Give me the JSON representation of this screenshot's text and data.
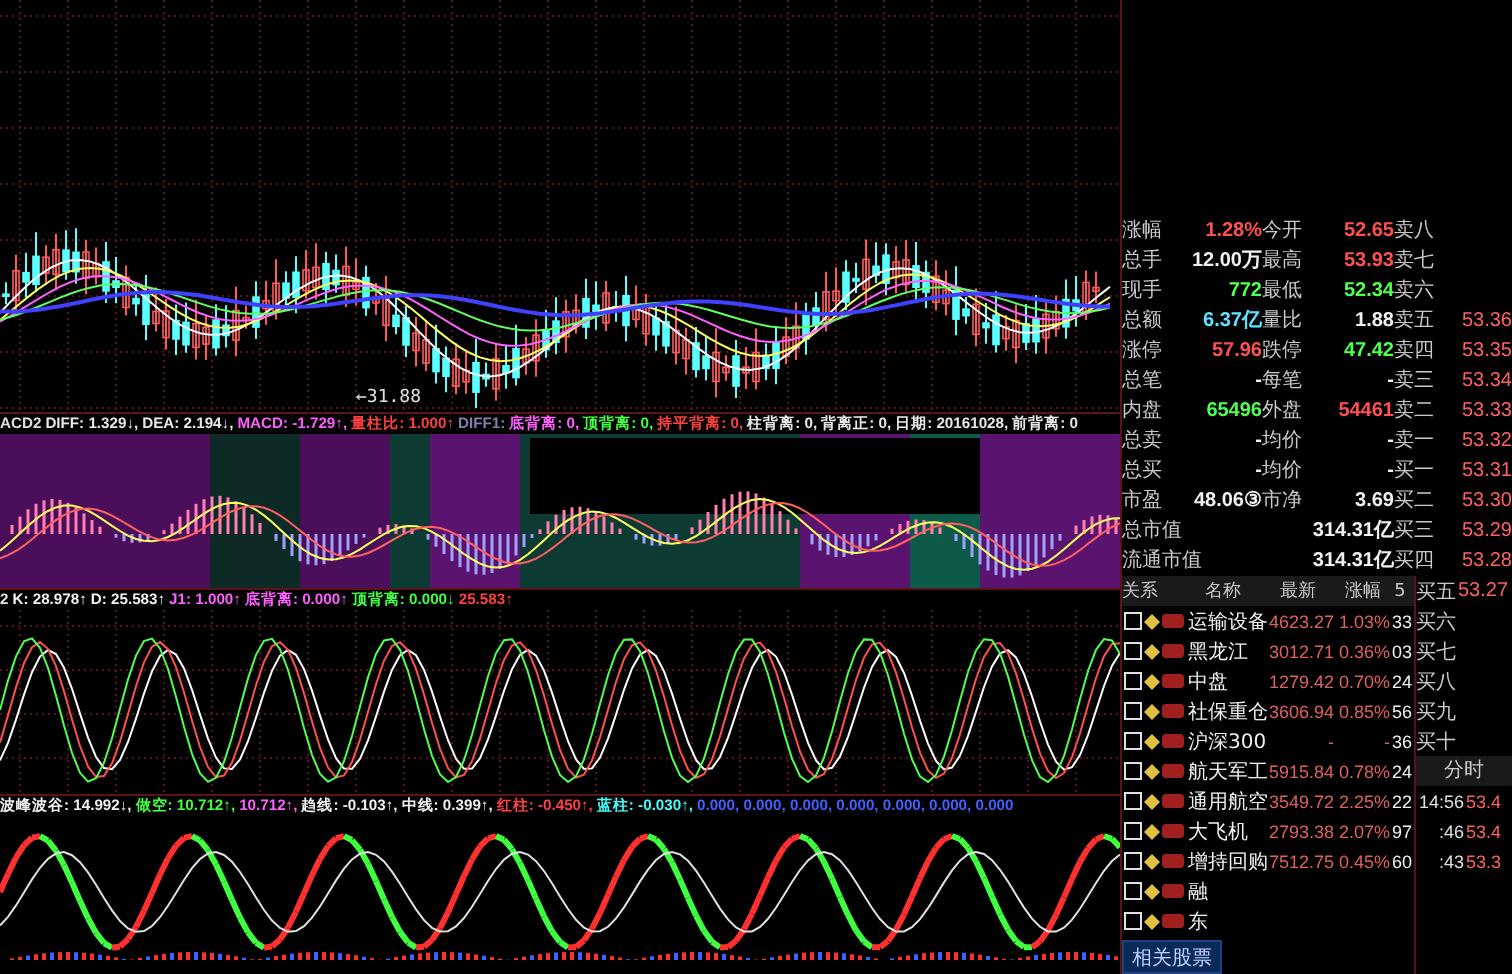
{
  "price_chart": {
    "low_label": "←31.88"
  },
  "macd": {
    "title": "ACD2",
    "readouts": [
      {
        "text": "DIFF: 1.329↓,",
        "kind": "plain"
      },
      {
        "text": "DEA: 2.194↓,",
        "kind": "plain"
      },
      {
        "text": "MACD: -1.729↑,",
        "kind": "macd"
      },
      {
        "text": "量柱比: 1.000↑",
        "kind": "volume"
      },
      {
        "text": "DIFF1:",
        "kind": "muted"
      },
      {
        "text": "底背离: 0,",
        "kind": "bottom"
      },
      {
        "text": "顶背离: 0,",
        "kind": "top"
      },
      {
        "text": "持平背离: 0,",
        "kind": "flat"
      },
      {
        "text": "柱背离: 0,",
        "kind": "plain"
      },
      {
        "text": "背离正: 0,",
        "kind": "plain"
      },
      {
        "text": "日期: 20161028,",
        "kind": "plain"
      },
      {
        "text": "前背离: 0",
        "kind": "plain"
      }
    ]
  },
  "kdj": {
    "title": "2",
    "readouts": [
      {
        "text": "K: 28.978↑",
        "color": "#f0f0f0"
      },
      {
        "text": "D: 25.583↑",
        "color": "#f0f0f0"
      },
      {
        "text": "J1: 1.000↑",
        "color": "#ff60ff"
      },
      {
        "text": "底背离: 0.000↑",
        "color": "#ff60ff"
      },
      {
        "text": "顶背离: 0.000↓",
        "color": "#40ff40"
      },
      {
        "text": "25.583↑",
        "color": "#ff4040"
      }
    ]
  },
  "wave": {
    "readouts": [
      {
        "text": "波峰波谷: 14.992↓,",
        "color": "#f0f0f0"
      },
      {
        "text": "做空: 10.712↑,",
        "color": "#40ff40"
      },
      {
        "text": "10.712↑,",
        "color": "#ff60ff"
      },
      {
        "text": "趋线: -0.103↑,",
        "color": "#f0f0f0"
      },
      {
        "text": "中线: 0.399↑,",
        "color": "#f0f0f0"
      },
      {
        "text": "红柱: -0.450↑,",
        "color": "#ff4040"
      },
      {
        "text": "蓝柱: -0.030↑,",
        "color": "#40ffff"
      },
      {
        "text": "0.000, 0.000, 0.000, 0.000, 0.000,",
        "color": "#4060ff"
      },
      {
        "text": "0.000, 0.000",
        "color": "#4060ff"
      }
    ]
  },
  "quote": {
    "rows": [
      {
        "cells": [
          {
            "label": "涨幅",
            "value": "1.28%",
            "color": "#ff5050"
          },
          {
            "label": "今开",
            "value": "52.65",
            "color": "#ff5050"
          }
        ],
        "book": {
          "label": "卖八"
        }
      },
      {
        "cells": [
          {
            "label": "总手",
            "value": "12.00万",
            "color": "#f0f0f0"
          },
          {
            "label": "最高",
            "value": "53.93",
            "color": "#ff5050"
          }
        ],
        "book": {
          "label": "卖七"
        }
      },
      {
        "cells": [
          {
            "label": "现手",
            "value": "772",
            "color": "#50ff50"
          },
          {
            "label": "最低",
            "value": "52.34",
            "color": "#50ff50"
          }
        ],
        "book": {
          "label": "卖六"
        }
      },
      {
        "cells": [
          {
            "label": "总额",
            "value": "6.37亿",
            "color": "#60e0ff"
          },
          {
            "label": "量比",
            "value": "1.88",
            "color": "#f0f0f0"
          }
        ],
        "book": {
          "label": "卖五",
          "price": "53.36"
        }
      },
      {
        "cells": [
          {
            "label": "涨停",
            "value": "57.96",
            "color": "#ff5050"
          },
          {
            "label": "跌停",
            "value": "47.42",
            "color": "#50ff50"
          }
        ],
        "book": {
          "label": "卖四",
          "price": "53.35"
        }
      },
      {
        "cells": [
          {
            "label": "总笔",
            "value": "-",
            "color": "#f0f0f0"
          },
          {
            "label": "每笔",
            "value": "-",
            "color": "#f0f0f0"
          }
        ],
        "book": {
          "label": "卖三",
          "price": "53.34"
        }
      },
      {
        "cells": [
          {
            "label": "内盘",
            "value": "65496",
            "color": "#50ff50"
          },
          {
            "label": "外盘",
            "value": "54461",
            "color": "#ff5050"
          }
        ],
        "book": {
          "label": "卖二",
          "price": "53.33"
        }
      },
      {
        "cells": [
          {
            "label": "总卖",
            "value": "-",
            "color": "#f0f0f0"
          },
          {
            "label": "均价",
            "value": "-",
            "color": "#f0f0f0"
          }
        ],
        "book": {
          "label": "卖一",
          "price": "53.32"
        }
      },
      {
        "cells": [
          {
            "label": "总买",
            "value": "-",
            "color": "#f0f0f0"
          },
          {
            "label": "均价",
            "value": "-",
            "color": "#f0f0f0"
          }
        ],
        "book": {
          "label": "买一",
          "price": "53.31"
        }
      },
      {
        "cells": [
          {
            "label": "市盈",
            "value": "48.06③",
            "color": "#f0f0f0"
          },
          {
            "label": "市净",
            "value": "3.69",
            "color": "#f0f0f0"
          }
        ],
        "book": {
          "label": "买二",
          "price": "53.30"
        }
      },
      {
        "cells": [
          {
            "label": "总市值",
            "value": "314.31亿",
            "color": "#f0f0f0"
          }
        ],
        "book": {
          "label": "买三",
          "price": "53.29"
        }
      },
      {
        "cells": [
          {
            "label": "流通市值",
            "value": "314.31亿",
            "color": "#f0f0f0"
          }
        ],
        "book": {
          "label": "买四",
          "price": "53.28"
        }
      }
    ]
  },
  "sector_list": {
    "columns": [
      "关系",
      "名称",
      "最新",
      "涨幅",
      "5"
    ],
    "rows": [
      {
        "checked": false,
        "name": "运输设备",
        "last": "4623.27",
        "change": "1.03%",
        "col_5": "33"
      },
      {
        "checked": false,
        "name": "黑龙江",
        "last": "3012.71",
        "change": "0.36%",
        "col_5": "03"
      },
      {
        "checked": false,
        "name": "中盘",
        "last": "1279.42",
        "change": "0.70%",
        "col_5": "24"
      },
      {
        "checked": false,
        "name": "社保重仓",
        "last": "3606.94",
        "change": "0.85%",
        "col_5": "56"
      },
      {
        "checked": false,
        "name": "沪深300",
        "last": "-",
        "change": "-",
        "col_5": "36"
      },
      {
        "checked": false,
        "name": "航天军工",
        "last": "5915.84",
        "change": "0.78%",
        "col_5": "24"
      },
      {
        "checked": false,
        "name": "通用航空",
        "last": "3549.72",
        "change": "2.25%",
        "col_5": "22"
      },
      {
        "checked": false,
        "name": "大飞机",
        "last": "2793.38",
        "change": "2.07%",
        "col_5": "97"
      },
      {
        "checked": false,
        "name": "增持回购",
        "last": "7512.75",
        "change": "0.45%",
        "col_5": "60"
      },
      {
        "checked": false,
        "name": "融"
      },
      {
        "checked": false,
        "name": "东"
      }
    ],
    "tab": "相关股票"
  },
  "order_book_more": [
    {
      "label": "买五",
      "price": "53.27"
    },
    {
      "label": "买六"
    },
    {
      "label": "买七"
    },
    {
      "label": "买八"
    },
    {
      "label": "买九"
    },
    {
      "label": "买十"
    }
  ],
  "time_sales": {
    "title": "分时",
    "rows": [
      {
        "time": "14:56",
        "price": "53.4"
      },
      {
        "time": ":46",
        "price": "53.4"
      },
      {
        "time": ":43",
        "price": "53.3"
      }
    ]
  }
}
